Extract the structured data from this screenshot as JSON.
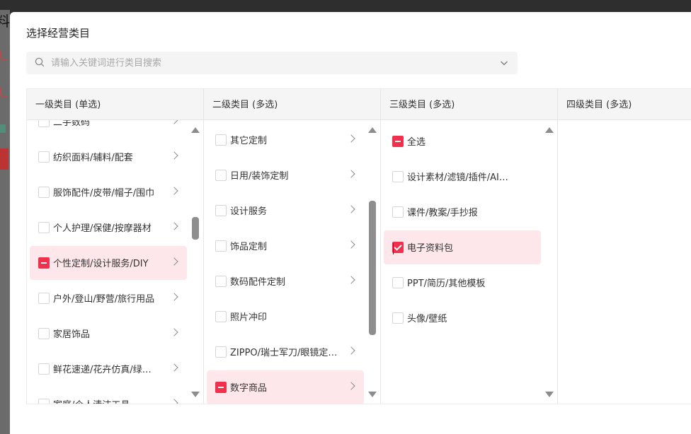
{
  "background": {
    "fragment_char": "料"
  },
  "modal": {
    "title": "选择经营类目",
    "search": {
      "placeholder": "请输入关键词进行类目搜索",
      "value": ""
    }
  },
  "columns": [
    {
      "header": "一级类目 (单选)",
      "scroll_fraction": 0.35,
      "items": [
        {
          "label": "二手数码",
          "state": "none",
          "has_children": true,
          "active": false
        },
        {
          "label": "纺织面料/辅料/配套",
          "state": "none",
          "has_children": true,
          "active": false
        },
        {
          "label": "服饰配件/皮带/帽子/围巾",
          "state": "none",
          "has_children": true,
          "active": false
        },
        {
          "label": "个人护理/保健/按摩器材",
          "state": "none",
          "has_children": true,
          "active": false
        },
        {
          "label": "个性定制/设计服务/DIY",
          "state": "partial",
          "has_children": true,
          "active": true
        },
        {
          "label": "户外/登山/野营/旅行用品",
          "state": "none",
          "has_children": true,
          "active": false
        },
        {
          "label": "家居饰品",
          "state": "none",
          "has_children": true,
          "active": false
        },
        {
          "label": "鲜花速递/花卉仿真/绿…",
          "state": "none",
          "has_children": true,
          "active": false
        },
        {
          "label": "家庭/个人清洁工具",
          "state": "none",
          "has_children": true,
          "active": false
        }
      ]
    },
    {
      "header": "二级类目 (多选)",
      "scroll_fraction": 0.55,
      "items": [
        {
          "label": "其它定制",
          "state": "none",
          "has_children": true,
          "active": false
        },
        {
          "label": "日用/装饰定制",
          "state": "none",
          "has_children": true,
          "active": false
        },
        {
          "label": "设计服务",
          "state": "none",
          "has_children": true,
          "active": false
        },
        {
          "label": "饰品定制",
          "state": "none",
          "has_children": true,
          "active": false
        },
        {
          "label": "数码配件定制",
          "state": "none",
          "has_children": true,
          "active": false
        },
        {
          "label": "照片冲印",
          "state": "none",
          "has_children": false,
          "active": false
        },
        {
          "label": "ZIPPO/瑞士军刀/眼镜定…",
          "state": "none",
          "has_children": true,
          "active": false
        },
        {
          "label": "数字商品",
          "state": "partial",
          "has_children": true,
          "active": true
        }
      ]
    },
    {
      "header": "三级类目 (多选)",
      "scroll_fraction": 0.0,
      "items": [
        {
          "label": "全选",
          "state": "partial",
          "has_children": false,
          "active": false
        },
        {
          "label": "设计素材/滤镜/插件/AI…",
          "state": "none",
          "has_children": false,
          "active": false
        },
        {
          "label": "课件/教案/手抄报",
          "state": "none",
          "has_children": false,
          "active": false
        },
        {
          "label": "电子资料包",
          "state": "checked",
          "has_children": false,
          "active": true
        },
        {
          "label": "PPT/简历/其他模板",
          "state": "none",
          "has_children": false,
          "active": false
        },
        {
          "label": "头像/壁纸",
          "state": "none",
          "has_children": false,
          "active": false
        }
      ]
    },
    {
      "header": "四级类目 (多选)",
      "items": []
    }
  ],
  "colors": {
    "accent": "#f0304c",
    "active_bg": "#fde7ea"
  },
  "icons": [
    "search-icon",
    "chevron-down-icon",
    "chevron-right-icon",
    "scroll-up-arrow-icon",
    "scroll-down-arrow-icon"
  ]
}
